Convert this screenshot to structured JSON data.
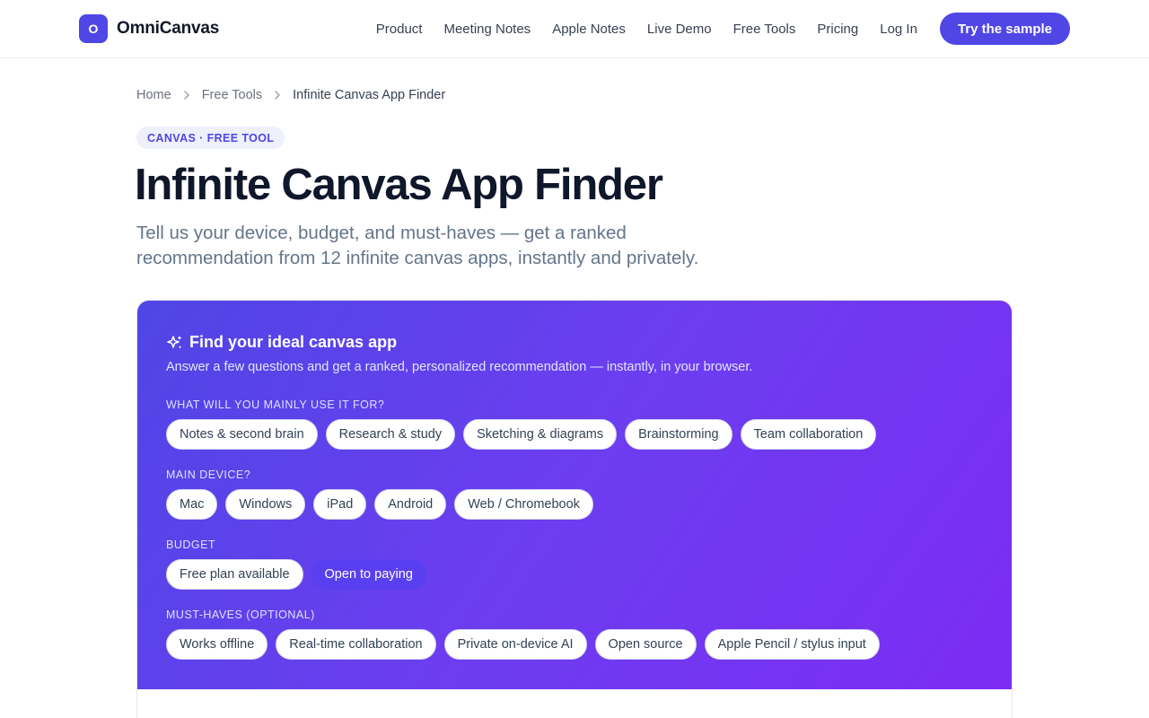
{
  "header": {
    "logo_letter": "O",
    "brand": "OmniCanvas",
    "nav": [
      "Product",
      "Meeting Notes",
      "Apple Notes",
      "Live Demo",
      "Free Tools",
      "Pricing",
      "Log In"
    ],
    "cta": "Try the sample"
  },
  "breadcrumb": [
    "Home",
    "Free Tools",
    "Infinite Canvas App Finder"
  ],
  "hero": {
    "pill": "CANVAS · FREE TOOL",
    "title": "Infinite Canvas App Finder",
    "subtitle": "Tell us your device, budget, and must-haves — get a ranked recommendation from 12 infinite canvas apps, instantly and privately."
  },
  "finder": {
    "title": "Find your ideal canvas app",
    "description": "Answer a few questions and get a ranked, personalized recommendation — instantly, in your browser.",
    "questions": [
      {
        "label": "WHAT WILL YOU MAINLY USE IT FOR?",
        "options": [
          "Notes & second brain",
          "Research & study",
          "Sketching & diagrams",
          "Brainstorming",
          "Team collaboration"
        ],
        "selected": []
      },
      {
        "label": "MAIN DEVICE?",
        "options": [
          "Mac",
          "Windows",
          "iPad",
          "Android",
          "Web / Chromebook"
        ],
        "selected": []
      },
      {
        "label": "BUDGET",
        "options": [
          "Free plan available",
          "Open to paying"
        ],
        "selected": [
          1
        ]
      },
      {
        "label": "MUST-HAVES (OPTIONAL)",
        "options": [
          "Works offline",
          "Real-time collaboration",
          "Private on-device AI",
          "Open source",
          "Apple Pencil / stylus input"
        ],
        "selected": []
      }
    ]
  },
  "colors": {
    "accent": "#4f46e5",
    "gradient_end": "#7c2cf3"
  }
}
